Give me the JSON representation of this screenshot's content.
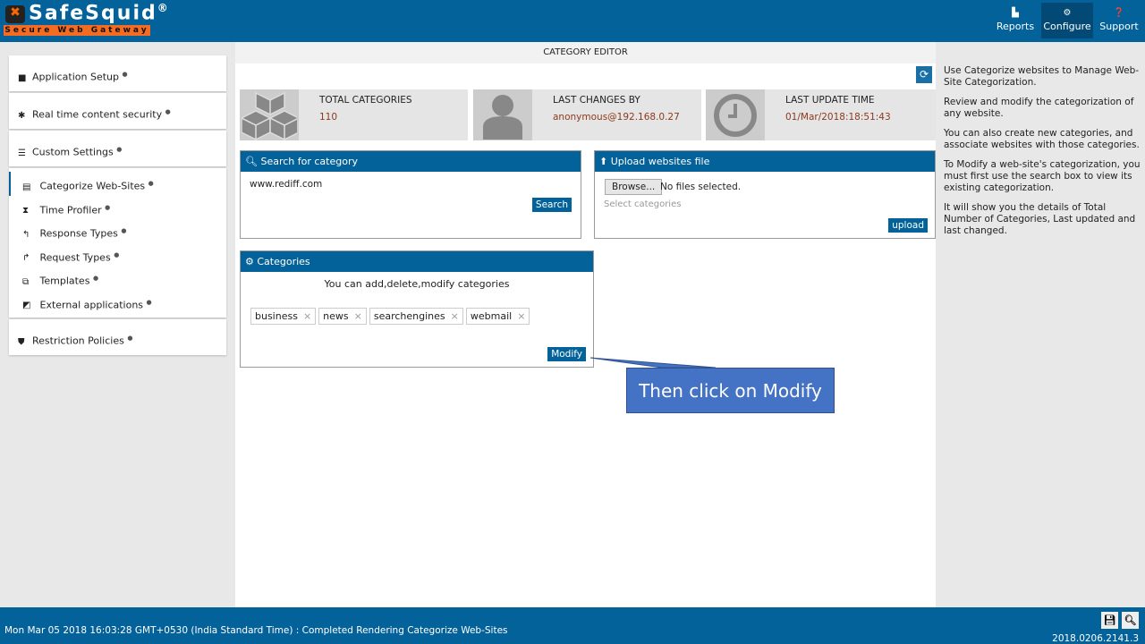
{
  "brand": {
    "name": "SafeSquid",
    "registered": "®",
    "tagline": "Secure Web Gateway"
  },
  "nav": [
    {
      "label": "Reports",
      "icon": "chart-area-icon"
    },
    {
      "label": "Configure",
      "icon": "cogs-icon",
      "active": true
    },
    {
      "label": "Support",
      "icon": "question-circle-icon"
    }
  ],
  "sidebar": {
    "groups": [
      {
        "label": "Application Setup",
        "icon": "briefcase-icon"
      },
      {
        "label": "Real time content security",
        "icon": "bug-icon"
      },
      {
        "label": "Custom Settings",
        "icon": "sliders-icon"
      }
    ],
    "sub": [
      {
        "label": "Categorize Web-Sites",
        "icon": "database-icon",
        "selected": true
      },
      {
        "label": "Time Profiler",
        "icon": "hourglass-icon"
      },
      {
        "label": "Response Types",
        "icon": "reply-icon"
      },
      {
        "label": "Request Types",
        "icon": "share-icon"
      },
      {
        "label": "Templates",
        "icon": "object-group-icon"
      },
      {
        "label": "External applications",
        "icon": "external-link-icon"
      }
    ],
    "last": {
      "label": "Restriction Policies",
      "icon": "shield-icon"
    }
  },
  "main": {
    "title": "CATEGORY EDITOR",
    "stats": [
      {
        "label": "TOTAL CATEGORIES",
        "value": "110"
      },
      {
        "label": "LAST CHANGES BY",
        "value": "anonymous@192.168.0.27"
      },
      {
        "label": "LAST UPDATE TIME",
        "value": "01/Mar/2018:18:51:43"
      }
    ],
    "search": {
      "title": "Search for category",
      "value": "www.rediff.com",
      "button": "Search"
    },
    "upload": {
      "title": "Upload websites file",
      "browse": "Browse...",
      "file_status": "No files selected.",
      "placeholder": "Select categories",
      "button": "upload"
    },
    "categories": {
      "title": "Categories",
      "hint": "You can add,delete,modify categories",
      "tags": [
        "business",
        "news",
        "searchengines",
        "webmail"
      ],
      "button": "Modify"
    }
  },
  "help": [
    "Use Categorize websites to Manage Web-Site Categorization.",
    "Review and modify the categorization of any website.",
    "You can also create new categories, and associate websites with those categories.",
    "To Modify a web-site's categorization, you must first use the search box to view its existing categorization.",
    "It will show you the details of Total Number of Categories, Last updated and last changed."
  ],
  "callout": "Then click on Modify",
  "footer": {
    "status": "Mon Mar 05 2018 16:03:28 GMT+0530 (India Standard Time) : Completed Rendering Categorize Web-Sites",
    "version": "2018.0206.2141.3"
  }
}
